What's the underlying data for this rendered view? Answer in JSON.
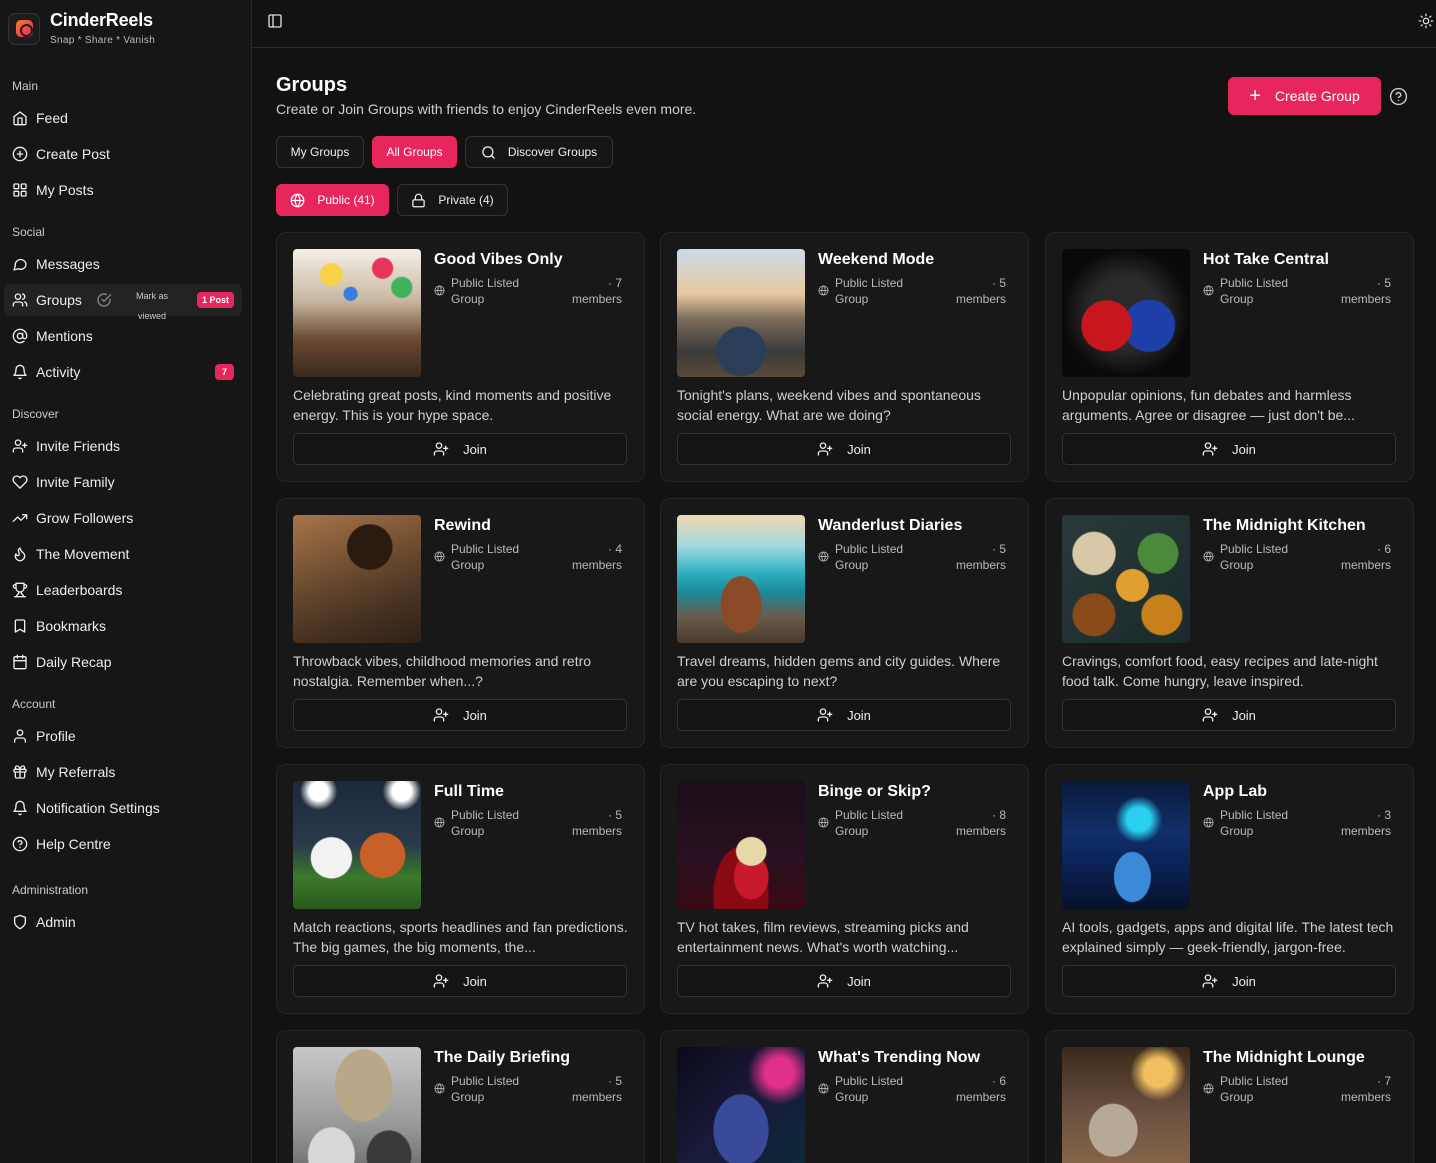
{
  "brand": {
    "name": "CinderReels",
    "tagline": "Snap * Share * Vanish"
  },
  "sidebar": {
    "sections": {
      "main": "Main",
      "social": "Social",
      "discover": "Discover",
      "account": "Account",
      "administration": "Administration"
    },
    "items": {
      "feed": "Feed",
      "create_post": "Create Post",
      "my_posts": "My Posts",
      "messages": "Messages",
      "groups": "Groups",
      "mentions": "Mentions",
      "activity": "Activity",
      "invite_friends": "Invite Friends",
      "invite_family": "Invite Family",
      "grow_followers": "Grow Followers",
      "the_movement": "The Movement",
      "leaderboards": "Leaderboards",
      "bookmarks": "Bookmarks",
      "daily_recap": "Daily Recap",
      "profile": "Profile",
      "my_referrals": "My Referrals",
      "notification_settings": "Notification Settings",
      "help_centre": "Help Centre",
      "admin": "Admin"
    },
    "groups_mark_viewed": "Mark as viewed",
    "groups_badge": "1 Post",
    "activity_badge": "7"
  },
  "header": {
    "title": "Groups",
    "subtitle": "Create or Join Groups with friends to enjoy CinderReels even more.",
    "create_label": "Create Group"
  },
  "tabs": {
    "my_groups": "My Groups",
    "all_groups": "All Groups",
    "discover_groups": "Discover Groups"
  },
  "filters": {
    "public": "Public (41)",
    "private": "Private (4)"
  },
  "colors": {
    "accent": "#e8265e",
    "background": "#121212",
    "card": "#181818"
  },
  "join_label": "Join",
  "groups": [
    {
      "name": "Good Vibes Only",
      "type": "Public Listed Group",
      "members": "· 7 members",
      "description": "Celebrating great posts, kind moments and positive energy. This is your hype space."
    },
    {
      "name": "Weekend Mode",
      "type": "Public Listed Group",
      "members": "· 5 members",
      "description": "Tonight's plans, weekend vibes and spontaneous social energy. What are we doing?"
    },
    {
      "name": "Hot Take Central",
      "type": "Public Listed Group",
      "members": "· 5 members",
      "description": "Unpopular opinions, fun debates and harmless arguments. Agree or disagree — just don't be..."
    },
    {
      "name": "Rewind",
      "type": "Public Listed Group",
      "members": "· 4 members",
      "description": "Throwback vibes, childhood memories and retro nostalgia. Remember when...?"
    },
    {
      "name": "Wanderlust Diaries",
      "type": "Public Listed Group",
      "members": "· 5 members",
      "description": "Travel dreams, hidden gems and city guides. Where are you escaping to next?"
    },
    {
      "name": "The Midnight Kitchen",
      "type": "Public Listed Group",
      "members": "· 6 members",
      "description": "Cravings, comfort food, easy recipes and late-night food talk. Come hungry, leave inspired."
    },
    {
      "name": "Full Time",
      "type": "Public Listed Group",
      "members": "· 5 members",
      "description": "Match reactions, sports headlines and fan predictions. The big games, the big moments, the..."
    },
    {
      "name": "Binge or Skip?",
      "type": "Public Listed Group",
      "members": "· 8 members",
      "description": "TV hot takes, film reviews, streaming picks and entertainment news. What's worth watching..."
    },
    {
      "name": "App Lab",
      "type": "Public Listed Group",
      "members": "· 3 members",
      "description": "AI tools, gadgets, apps and digital life. The latest tech explained simply — geek-friendly, jargon-free."
    },
    {
      "name": "The Daily Briefing",
      "type": "Public Listed Group",
      "members": "· 5 members",
      "description": ""
    },
    {
      "name": "What's Trending Now",
      "type": "Public Listed Group",
      "members": "· 6 members",
      "description": ""
    },
    {
      "name": "The Midnight Lounge",
      "type": "Public Listed Group",
      "members": "· 7 members",
      "description": ""
    }
  ]
}
